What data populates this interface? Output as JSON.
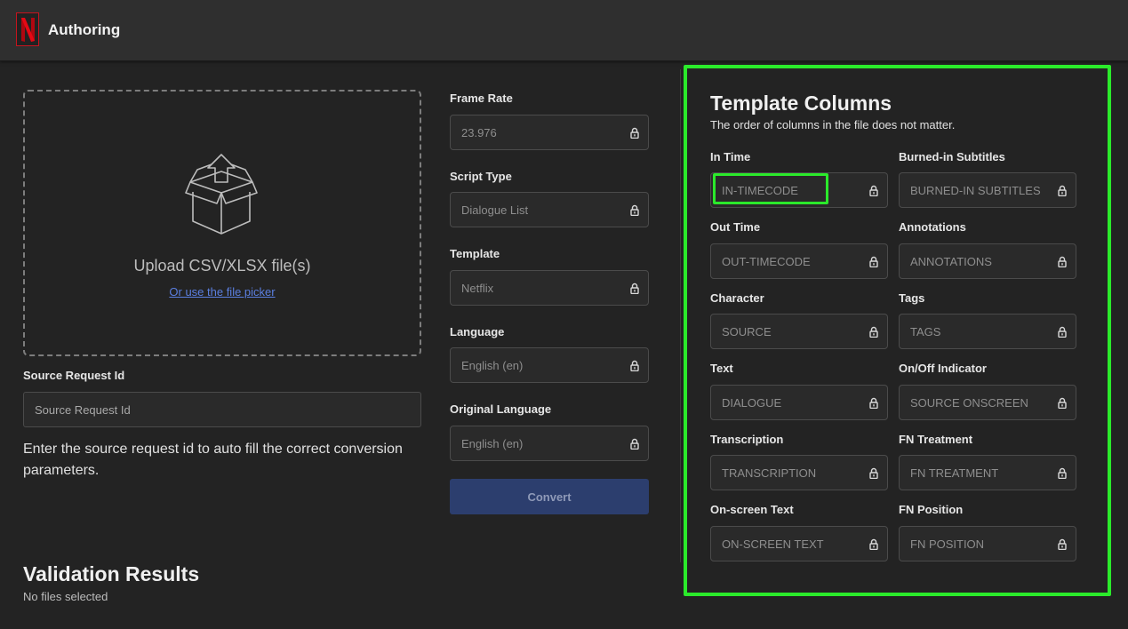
{
  "header": {
    "app_title": "Authoring",
    "logo_letter": "N",
    "brand_color": "#e50914"
  },
  "upload": {
    "title": "Upload CSV/XLSX file(s)",
    "file_picker_link": "Or use the file picker",
    "icon": "open-box-upload-icon"
  },
  "source_request": {
    "label": "Source Request Id",
    "placeholder": "Source Request Id",
    "help": "Enter the source request id to auto fill the correct conversion parameters."
  },
  "params": [
    {
      "label": "Frame Rate",
      "value": "23.976"
    },
    {
      "label": "Script Type",
      "value": "Dialogue List"
    },
    {
      "label": "Template",
      "value": "Netflix"
    },
    {
      "label": "Language",
      "value": "English (en)"
    },
    {
      "label": "Original Language",
      "value": "English (en)"
    }
  ],
  "convert_label": "Convert",
  "validation": {
    "title": "Validation Results",
    "subtitle": "No files selected"
  },
  "template_columns": {
    "title": "Template Columns",
    "subtitle": "The order of columns in the file does not matter.",
    "items": [
      {
        "label": "In Time",
        "value": "IN-TIMECODE"
      },
      {
        "label": "Burned-in Subtitles",
        "value": "BURNED-IN SUBTITLES"
      },
      {
        "label": "Out Time",
        "value": "OUT-TIMECODE"
      },
      {
        "label": "Annotations",
        "value": "ANNOTATIONS"
      },
      {
        "label": "Character",
        "value": "SOURCE"
      },
      {
        "label": "Tags",
        "value": "TAGS"
      },
      {
        "label": "Text",
        "value": "DIALOGUE"
      },
      {
        "label": "On/Off Indicator",
        "value": "SOURCE ONSCREEN"
      },
      {
        "label": "Transcription",
        "value": "TRANSCRIPTION"
      },
      {
        "label": "FN Treatment",
        "value": "FN TREATMENT"
      },
      {
        "label": "On-screen Text",
        "value": "ON-SCREEN TEXT"
      },
      {
        "label": "FN Position",
        "value": "FN POSITION"
      }
    ]
  },
  "colors": {
    "highlight": "#2bea2b",
    "accent_link": "#5b7fe0",
    "button_bg": "#2c3e6e"
  }
}
